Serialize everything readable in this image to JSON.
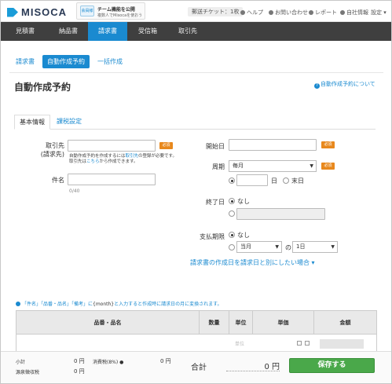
{
  "header": {
    "logo": "MISOCA",
    "promo_icon": "会員様",
    "promo_title": "チーム機能を公開",
    "promo_sub": "複数人でMisocaを使おう",
    "ticket": "郵送チケット：1枚",
    "help": "ヘルプ",
    "contact": "お問い合わせ",
    "report": "レポート",
    "company": "自社情報",
    "settings": "設定"
  },
  "nav": {
    "tabs": [
      "見積書",
      "納品書",
      "請求書",
      "受信箱",
      "取引先"
    ]
  },
  "subtabs": [
    "請求書",
    "自動作成予約",
    "一括作成"
  ],
  "page": {
    "title": "自動作成予約",
    "help_link": "自動作成予約について"
  },
  "form_tabs": [
    "基本情報",
    "課税設定"
  ],
  "form": {
    "customer_label_1": "取引先",
    "customer_label_2": "(請求先)",
    "required": "必須",
    "customer_note_1": "自動作成予約を作成するには",
    "customer_note_link": "取引先",
    "customer_note_2": "の登録が必要です。",
    "customer_note_3": "取引先は",
    "customer_note_link2": "こちら",
    "customer_note_4": "から作成できます。",
    "subject_label": "件名",
    "subject_count": "0/40",
    "start_label": "開始日",
    "cycle_label": "周期",
    "cycle_value": "毎月",
    "day_suffix": "日",
    "month_end": "末日",
    "end_label": "終了日",
    "none": "なし",
    "payment_label": "支払期限",
    "payment_month": "当月",
    "payment_of": "の",
    "payment_day": "1日",
    "separate_date_link": "請求書の作成日を請求日と別にしたい場合 ▾"
  },
  "hint": {
    "pre": "「件名」「品番・品名」「備考」に",
    "token": "{month}",
    "post": "と入力すると作成時に請求日の月に変換されます。"
  },
  "table": {
    "headers": [
      "品番・品名",
      "数量",
      "単位",
      "単価",
      "金額"
    ],
    "unit_placeholder": "単位"
  },
  "footer": {
    "subtotal_label": "小計",
    "subtotal_value": "0 円",
    "tax_label": "消費税(8%)",
    "tax_value": "0 円",
    "withholding_label": "源泉徴収税",
    "withholding_value": "0 円",
    "total_label": "合計",
    "total_value": "0 円",
    "save": "保存する"
  },
  "colors": {
    "accent": "#1a8ad0",
    "nav_bg": "#3f3f3f",
    "required": "#e8881c",
    "save": "#4aa84a"
  }
}
